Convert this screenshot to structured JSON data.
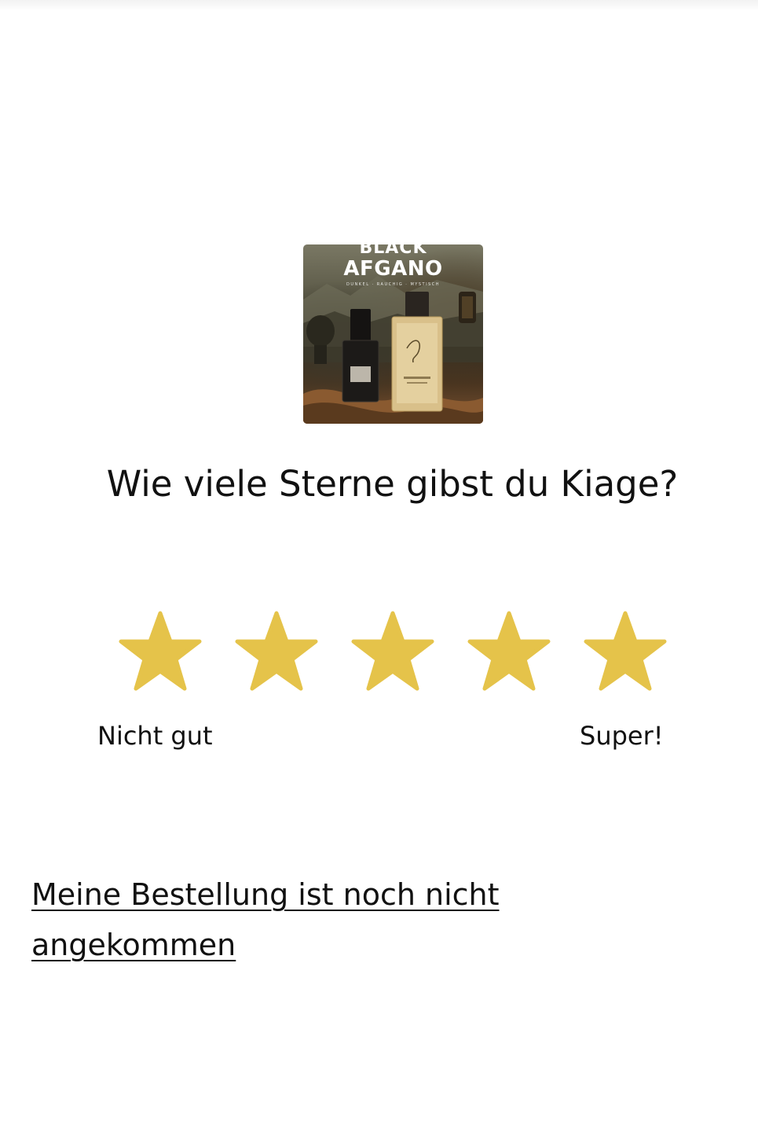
{
  "product": {
    "image_brand_top": "BLACK",
    "image_brand_main": "AFGANO",
    "image_brand_tagline": "DUNKEL · RAUCHIG · MYSTISCH"
  },
  "rating": {
    "question": "Wie viele Sterne gibst du Kiage?",
    "star_count": 5,
    "star_color": "#E5C34A",
    "star_icon": "star-icon",
    "label_low": "Nicht gut",
    "label_high": "Super!"
  },
  "footer": {
    "order_not_arrived_link": "Meine Bestellung ist noch nicht angekommen"
  }
}
